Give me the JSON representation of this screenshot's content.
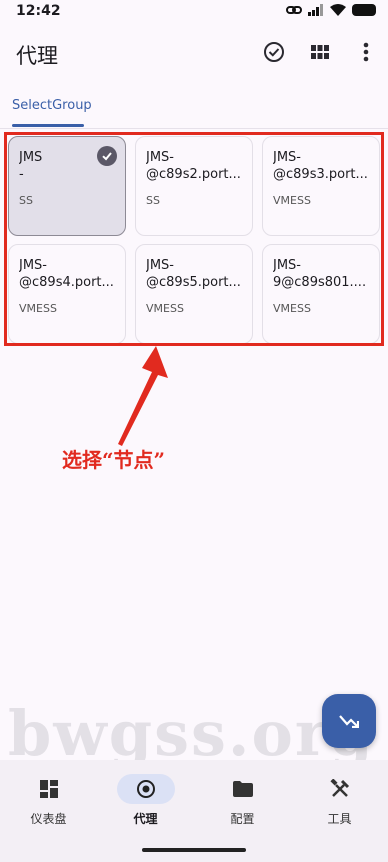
{
  "status": {
    "time": "12:42"
  },
  "app": {
    "title": "代理"
  },
  "icons": {
    "check": "check-circle-icon",
    "grid": "grid-view-icon",
    "more": "more-vert-icon"
  },
  "tabs": [
    {
      "label": "SelectGroup",
      "active": true
    }
  ],
  "nodes": [
    {
      "name": "JMS\n-",
      "type": "SS",
      "selected": true
    },
    {
      "name": "JMS-\n@c89s2.port...",
      "type": "SS",
      "selected": false
    },
    {
      "name": "JMS-\n@c89s3.port...",
      "type": "VMESS",
      "selected": false
    },
    {
      "name": "JMS-\n@c89s4.port...",
      "type": "VMESS",
      "selected": false
    },
    {
      "name": "JMS-\n@c89s5.port...",
      "type": "VMESS",
      "selected": false
    },
    {
      "name": "JMS-\n9@c89s801....",
      "type": "VMESS",
      "selected": false
    }
  ],
  "annotation": {
    "text": "选择“节点”",
    "color": "#e12a1f"
  },
  "watermark": {
    "text": "bwgss.org"
  },
  "nav": [
    {
      "label": "仪表盘",
      "icon": "dashboard-icon",
      "active": false
    },
    {
      "label": "代理",
      "icon": "proxy-icon",
      "active": true
    },
    {
      "label": "配置",
      "icon": "folder-icon",
      "active": false
    },
    {
      "label": "工具",
      "icon": "tools-icon",
      "active": false
    }
  ],
  "colors": {
    "accent": "#3a5fa8",
    "background": "#fcf8fd"
  }
}
